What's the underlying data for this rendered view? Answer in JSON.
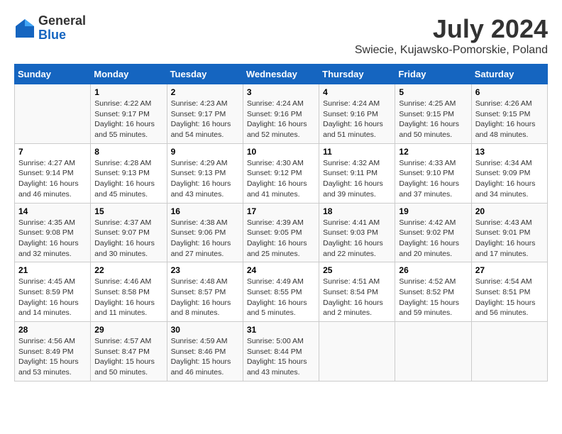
{
  "logo": {
    "general": "General",
    "blue": "Blue"
  },
  "title": "July 2024",
  "subtitle": "Swiecie, Kujawsko-Pomorskie, Poland",
  "headers": [
    "Sunday",
    "Monday",
    "Tuesday",
    "Wednesday",
    "Thursday",
    "Friday",
    "Saturday"
  ],
  "weeks": [
    [
      {
        "num": "",
        "info": ""
      },
      {
        "num": "1",
        "info": "Sunrise: 4:22 AM\nSunset: 9:17 PM\nDaylight: 16 hours\nand 55 minutes."
      },
      {
        "num": "2",
        "info": "Sunrise: 4:23 AM\nSunset: 9:17 PM\nDaylight: 16 hours\nand 54 minutes."
      },
      {
        "num": "3",
        "info": "Sunrise: 4:24 AM\nSunset: 9:16 PM\nDaylight: 16 hours\nand 52 minutes."
      },
      {
        "num": "4",
        "info": "Sunrise: 4:24 AM\nSunset: 9:16 PM\nDaylight: 16 hours\nand 51 minutes."
      },
      {
        "num": "5",
        "info": "Sunrise: 4:25 AM\nSunset: 9:15 PM\nDaylight: 16 hours\nand 50 minutes."
      },
      {
        "num": "6",
        "info": "Sunrise: 4:26 AM\nSunset: 9:15 PM\nDaylight: 16 hours\nand 48 minutes."
      }
    ],
    [
      {
        "num": "7",
        "info": "Sunrise: 4:27 AM\nSunset: 9:14 PM\nDaylight: 16 hours\nand 46 minutes."
      },
      {
        "num": "8",
        "info": "Sunrise: 4:28 AM\nSunset: 9:13 PM\nDaylight: 16 hours\nand 45 minutes."
      },
      {
        "num": "9",
        "info": "Sunrise: 4:29 AM\nSunset: 9:13 PM\nDaylight: 16 hours\nand 43 minutes."
      },
      {
        "num": "10",
        "info": "Sunrise: 4:30 AM\nSunset: 9:12 PM\nDaylight: 16 hours\nand 41 minutes."
      },
      {
        "num": "11",
        "info": "Sunrise: 4:32 AM\nSunset: 9:11 PM\nDaylight: 16 hours\nand 39 minutes."
      },
      {
        "num": "12",
        "info": "Sunrise: 4:33 AM\nSunset: 9:10 PM\nDaylight: 16 hours\nand 37 minutes."
      },
      {
        "num": "13",
        "info": "Sunrise: 4:34 AM\nSunset: 9:09 PM\nDaylight: 16 hours\nand 34 minutes."
      }
    ],
    [
      {
        "num": "14",
        "info": "Sunrise: 4:35 AM\nSunset: 9:08 PM\nDaylight: 16 hours\nand 32 minutes."
      },
      {
        "num": "15",
        "info": "Sunrise: 4:37 AM\nSunset: 9:07 PM\nDaylight: 16 hours\nand 30 minutes."
      },
      {
        "num": "16",
        "info": "Sunrise: 4:38 AM\nSunset: 9:06 PM\nDaylight: 16 hours\nand 27 minutes."
      },
      {
        "num": "17",
        "info": "Sunrise: 4:39 AM\nSunset: 9:05 PM\nDaylight: 16 hours\nand 25 minutes."
      },
      {
        "num": "18",
        "info": "Sunrise: 4:41 AM\nSunset: 9:03 PM\nDaylight: 16 hours\nand 22 minutes."
      },
      {
        "num": "19",
        "info": "Sunrise: 4:42 AM\nSunset: 9:02 PM\nDaylight: 16 hours\nand 20 minutes."
      },
      {
        "num": "20",
        "info": "Sunrise: 4:43 AM\nSunset: 9:01 PM\nDaylight: 16 hours\nand 17 minutes."
      }
    ],
    [
      {
        "num": "21",
        "info": "Sunrise: 4:45 AM\nSunset: 8:59 PM\nDaylight: 16 hours\nand 14 minutes."
      },
      {
        "num": "22",
        "info": "Sunrise: 4:46 AM\nSunset: 8:58 PM\nDaylight: 16 hours\nand 11 minutes."
      },
      {
        "num": "23",
        "info": "Sunrise: 4:48 AM\nSunset: 8:57 PM\nDaylight: 16 hours\nand 8 minutes."
      },
      {
        "num": "24",
        "info": "Sunrise: 4:49 AM\nSunset: 8:55 PM\nDaylight: 16 hours\nand 5 minutes."
      },
      {
        "num": "25",
        "info": "Sunrise: 4:51 AM\nSunset: 8:54 PM\nDaylight: 16 hours\nand 2 minutes."
      },
      {
        "num": "26",
        "info": "Sunrise: 4:52 AM\nSunset: 8:52 PM\nDaylight: 15 hours\nand 59 minutes."
      },
      {
        "num": "27",
        "info": "Sunrise: 4:54 AM\nSunset: 8:51 PM\nDaylight: 15 hours\nand 56 minutes."
      }
    ],
    [
      {
        "num": "28",
        "info": "Sunrise: 4:56 AM\nSunset: 8:49 PM\nDaylight: 15 hours\nand 53 minutes."
      },
      {
        "num": "29",
        "info": "Sunrise: 4:57 AM\nSunset: 8:47 PM\nDaylight: 15 hours\nand 50 minutes."
      },
      {
        "num": "30",
        "info": "Sunrise: 4:59 AM\nSunset: 8:46 PM\nDaylight: 15 hours\nand 46 minutes."
      },
      {
        "num": "31",
        "info": "Sunrise: 5:00 AM\nSunset: 8:44 PM\nDaylight: 15 hours\nand 43 minutes."
      },
      {
        "num": "",
        "info": ""
      },
      {
        "num": "",
        "info": ""
      },
      {
        "num": "",
        "info": ""
      }
    ]
  ]
}
